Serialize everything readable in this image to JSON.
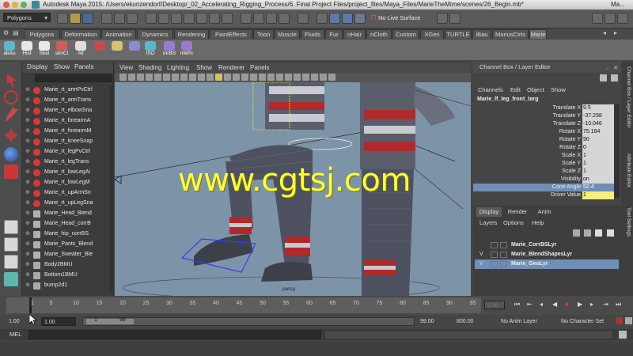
{
  "window": {
    "title": "Autodesk Maya 2015: /Users/ekunzendorf/Desktop/_02_Accelerating_Rigging_Process/6. Final Project Files/project_files/Maya_Files/MarieTheMime/scenes/26_Begin.mb*",
    "title_tail": "Ma..."
  },
  "statusline": {
    "menuset": "Polygons",
    "live_surface": "No Live Surface"
  },
  "shelf": {
    "tabs": [
      "Polygons",
      "Deformation",
      "Animation",
      "Dynamics",
      "Rendering",
      "PaintEffects",
      "Toon",
      "Muscle",
      "Fluids",
      "Fur",
      "nHair",
      "nCloth",
      "Custom",
      "XGen",
      "TURTLE",
      "iBau",
      "MariusCtrls",
      "Marie"
    ],
    "active_tab": "Marie",
    "buttons": [
      {
        "label": "abAu",
        "icon": "ab-autorig-icon",
        "color": "#5bb8c9"
      },
      {
        "label": "Hist",
        "icon": "delete-history-icon",
        "color": "#e8e8e8"
      },
      {
        "label": "Skel",
        "icon": "skeleton-icon",
        "color": "#e8e8e8"
      },
      {
        "label": "sknCl",
        "icon": "skin-cluster-icon",
        "color": "#d45a5a"
      },
      {
        "label": "All",
        "icon": "select-all-icon",
        "color": "#e0e0e0"
      },
      {
        "label": "",
        "icon": "paint-weights-icon",
        "color": "#c94a4a"
      },
      {
        "label": "",
        "icon": "brush-icon",
        "color": "#d8c070"
      },
      {
        "label": "",
        "icon": "mirror-icon",
        "color": "#8a8ad0"
      },
      {
        "label": "ISO",
        "icon": "isolate-icon",
        "color": "#5bb8c9"
      },
      {
        "label": "mrBS",
        "icon": "mirror-blendshape-icon",
        "color": "#9a7ad0"
      },
      {
        "label": "mkPc",
        "icon": "make-pose-icon",
        "color": "#9a7ad0"
      }
    ]
  },
  "outliner": {
    "menu": [
      "Display",
      "Show",
      "Panels"
    ],
    "items": [
      {
        "label": "Marie_rt_armPvCtrl",
        "icon": "nurbs-curve-icon",
        "color": "#d43a3a"
      },
      {
        "label": "Marie_rt_armTrans",
        "icon": "nurbs-curve-icon",
        "color": "#d43a3a"
      },
      {
        "label": "Marie_rt_elbowSna",
        "icon": "nurbs-curve-icon",
        "color": "#d43a3a"
      },
      {
        "label": "Marie_rt_forearmA",
        "icon": "nurbs-curve-icon",
        "color": "#d43a3a"
      },
      {
        "label": "Marie_rt_forearmM",
        "icon": "nurbs-curve-icon",
        "color": "#d43a3a"
      },
      {
        "label": "Marie_rt_kneeSnap",
        "icon": "nurbs-curve-icon",
        "color": "#d43a3a"
      },
      {
        "label": "Marie_rt_legPvCtrl",
        "icon": "nurbs-curve-icon",
        "color": "#d43a3a"
      },
      {
        "label": "Marie_rt_legTrans",
        "icon": "nurbs-curve-icon",
        "color": "#d43a3a"
      },
      {
        "label": "Marie_rt_lowLegAi",
        "icon": "nurbs-curve-icon",
        "color": "#d43a3a"
      },
      {
        "label": "Marie_rt_lowLegM",
        "icon": "nurbs-curve-icon",
        "color": "#d43a3a"
      },
      {
        "label": "Marie_rt_upArmSn",
        "icon": "nurbs-curve-icon",
        "color": "#d43a3a"
      },
      {
        "label": "Marie_rt_upLegSna",
        "icon": "nurbs-curve-icon",
        "color": "#d43a3a"
      },
      {
        "label": "Marie_Head_Blend",
        "icon": "mesh-icon",
        "color": "#b0b0b0"
      },
      {
        "label": "Marie_Head_corrB",
        "icon": "mesh-icon",
        "color": "#b0b0b0"
      },
      {
        "label": "Marie_hip_corrBS",
        "icon": "mesh-icon",
        "color": "#b0b0b0"
      },
      {
        "label": "Marie_Pants_Blend",
        "icon": "mesh-icon",
        "color": "#b0b0b0"
      },
      {
        "label": "Marie_Sweater_Ble",
        "icon": "mesh-icon",
        "color": "#b0b0b0"
      },
      {
        "label": "Body2BMU",
        "icon": "bmu-icon",
        "color": "#a9a9a9"
      },
      {
        "label": "Bottom1BMU",
        "icon": "bmu-icon",
        "color": "#a9a9a9"
      },
      {
        "label": "bump2d1",
        "icon": "texture-icon",
        "color": "#a9a9a9"
      }
    ]
  },
  "viewport": {
    "menu": [
      "View",
      "Shading",
      "Lighting",
      "Show",
      "Renderer",
      "Panels"
    ],
    "watermark": "www.cgtsj.com",
    "persp_label": "persp"
  },
  "channelbox": {
    "title": "Channel Box / Layer Editor",
    "menu": [
      "Channels",
      "Edit",
      "Object",
      "Show"
    ],
    "object": "Marie_lf_leg_front_targ",
    "attributes": [
      {
        "name": "Translate X",
        "value": "9.5"
      },
      {
        "name": "Translate Y",
        "value": "-37.298"
      },
      {
        "name": "Translate Z",
        "value": "-10.046"
      },
      {
        "name": "Rotate X",
        "value": "75.184"
      },
      {
        "name": "Rotate Y",
        "value": "90"
      },
      {
        "name": "Rotate Z",
        "value": "0"
      },
      {
        "name": "Scale X",
        "value": "1"
      },
      {
        "name": "Scale Y",
        "value": "1"
      },
      {
        "name": "Scale Z",
        "value": "1"
      },
      {
        "name": "Visibility",
        "value": "on"
      },
      {
        "name": "Cone Angle",
        "value": "52.4"
      },
      {
        "name": "Driver Value",
        "value": "1"
      }
    ]
  },
  "sidetabs": [
    "Channel Box / Layer Editor",
    "Attribute Editor",
    "Tool Settings"
  ],
  "layers": {
    "tabs": [
      "Display",
      "Render",
      "Anim"
    ],
    "menu": [
      "Layers",
      "Options",
      "Help"
    ],
    "rows": [
      {
        "name": "Marie_CorrBSLyr",
        "v": "",
        "selected": false
      },
      {
        "name": "Marie_BlendShapesLyr",
        "v": "V",
        "selected": false
      },
      {
        "name": "Marie_GeoLyr",
        "v": "V",
        "selected": true
      }
    ]
  },
  "timeline": {
    "ticks": [
      "1",
      "5",
      "10",
      "15",
      "20",
      "25",
      "30",
      "35",
      "40",
      "45",
      "50",
      "55",
      "60",
      "65",
      "70",
      "75",
      "80",
      "85",
      "90",
      "95"
    ],
    "current_frame": "1.00"
  },
  "range": {
    "start": "1.00",
    "inner_start": "1.00",
    "slider_start": "1",
    "slider_end": "99",
    "inner_end": "99.00",
    "end": "800.00",
    "anim_layer": "No Anim Layer",
    "char_set": "No Character Set"
  },
  "command": {
    "label": "MEL"
  },
  "colors": {
    "accent_selection": "#6f8fb6",
    "driver_value_highlight": "#f5f07a",
    "viewport_bg": "#7d93a8",
    "watermark": "#ffff33"
  }
}
